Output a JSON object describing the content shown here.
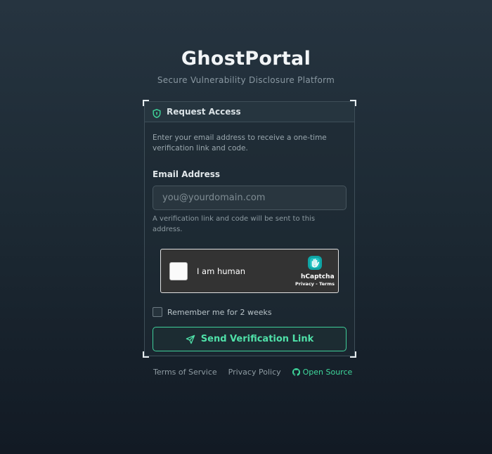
{
  "header": {
    "title": "GhostPortal",
    "subtitle": "Secure Vulnerability Disclosure Platform"
  },
  "card": {
    "heading": "Request Access",
    "heading_icon": "shield-icon",
    "description": "Enter your email address to receive a one-time verification link and code.",
    "email_label": "Email Address",
    "email_placeholder": "you@yourdomain.com",
    "email_value": "",
    "hint": "A verification link and code will be sent to this address.",
    "captcha": {
      "label": "I am human",
      "brand": "hCaptcha",
      "links": "Privacy - Terms",
      "checked": false
    },
    "remember_label": "Remember me for 2 weeks",
    "remember_checked": false,
    "send_label": "Send Verification Link",
    "send_icon": "send-icon"
  },
  "footer": {
    "terms": "Terms of Service",
    "privacy": "Privacy Policy",
    "open_source": "Open Source",
    "open_source_icon": "github-icon"
  },
  "colors": {
    "accent": "#3fd89c",
    "background_top": "#263440",
    "background_bottom": "#121a24",
    "captcha_bg": "#333333"
  }
}
